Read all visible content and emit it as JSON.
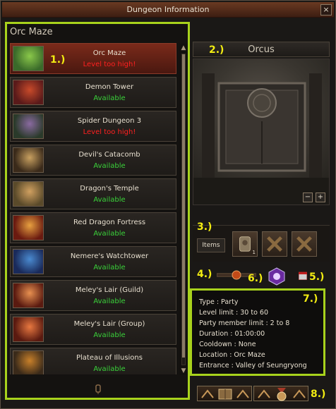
{
  "window": {
    "title": "Dungeon Information",
    "close_label": "×"
  },
  "list_panel": {
    "header": "Orc Maze"
  },
  "dungeons": [
    {
      "name": "Orc Maze",
      "status": "Level too high!",
      "status_type": "bad",
      "selected": true
    },
    {
      "name": "Demon Tower",
      "status": "Available",
      "status_type": "ok"
    },
    {
      "name": "Spider Dungeon 3",
      "status": "Level too high!",
      "status_type": "bad"
    },
    {
      "name": "Devil's Catacomb",
      "status": "Available",
      "status_type": "ok"
    },
    {
      "name": "Dragon's Temple",
      "status": "Available",
      "status_type": "ok"
    },
    {
      "name": "Red Dragon Fortress",
      "status": "Available",
      "status_type": "ok"
    },
    {
      "name": "Nemere's Watchtower",
      "status": "Available",
      "status_type": "ok"
    },
    {
      "name": "Meley's Lair (Guild)",
      "status": "Available",
      "status_type": "ok"
    },
    {
      "name": "Meley's Lair (Group)",
      "status": "Available",
      "status_type": "ok"
    },
    {
      "name": "Plateau of Illusions",
      "status": "Available",
      "status_type": "ok"
    }
  ],
  "preview": {
    "title": "Orcus",
    "zoom_out": "−",
    "zoom_in": "+"
  },
  "items": {
    "label": "Items",
    "slot_count": "1"
  },
  "info": {
    "lines": [
      "Type : Party",
      "Level limit : 30 to 60",
      "Party member limit : 2 to 8",
      "Duration : 01:00:00",
      "Cooldown : None",
      "Location : Orc Maze",
      "Entrance : Valley of Seungryong"
    ]
  },
  "markers": [
    "1.)",
    "2.)",
    "3.)",
    "4.)",
    "5.)",
    "6.)",
    "7.)",
    "8.)"
  ],
  "colors": {
    "highlight": "#a8d21c",
    "marker": "#f2ec12",
    "ok": "#3ad23a",
    "bad": "#ff2020"
  }
}
